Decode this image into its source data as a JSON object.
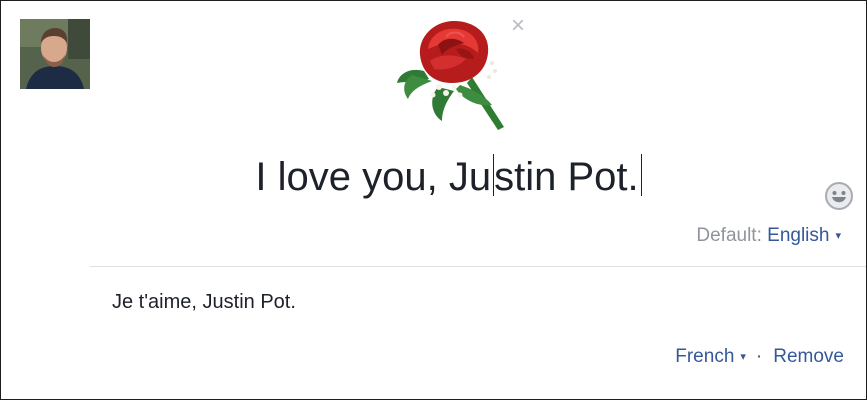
{
  "composer": {
    "close_glyph": "×",
    "text_before_cursor": "I love you, Ju",
    "text_after_cursor": "stin Pot.",
    "background_icon": "rose-icon",
    "emoji_icon": "smiley-icon"
  },
  "language": {
    "default_label": "Default:",
    "default_value": "English",
    "dropdown_glyph": "▾"
  },
  "translation": {
    "text": "Je t'aime, Justin Pot.",
    "language": "French",
    "dropdown_glyph": "▾",
    "separator": "·",
    "remove_label": "Remove"
  },
  "colors": {
    "link": "#365899",
    "text": "#1d2129",
    "muted": "#90949c",
    "divider": "#dddfe2"
  }
}
